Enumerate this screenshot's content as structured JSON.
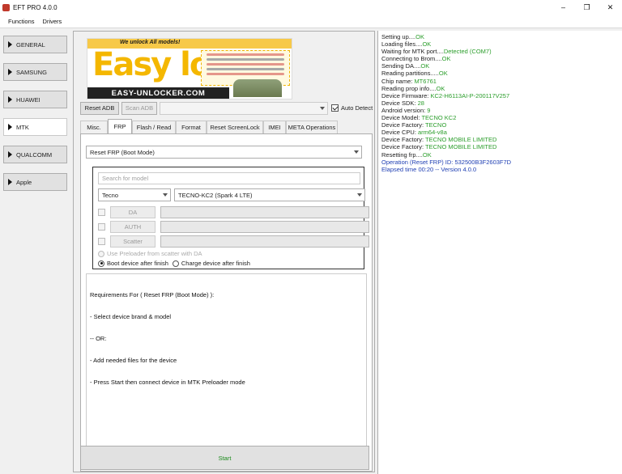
{
  "window": {
    "title": "EFT PRO 4.0.0",
    "minimize": "–",
    "restore": "❐",
    "close": "✕"
  },
  "menu": [
    "Functions",
    "Drivers"
  ],
  "sidebar": [
    {
      "label": "GENERAL",
      "active": false
    },
    {
      "label": "SAMSUNG",
      "active": false
    },
    {
      "label": "HUAWEI",
      "active": false
    },
    {
      "label": "MTK",
      "active": true
    },
    {
      "label": "QUALCOMM",
      "active": false
    },
    {
      "label": "Apple",
      "active": false
    }
  ],
  "banner": {
    "tagline": "We unlock All models!",
    "logo_text": "Easy locker",
    "url": "EASY-UNLOCKER.COM"
  },
  "adb": {
    "reset_label": "Reset ADB",
    "scan_label": "Scan ADB",
    "device_value": "",
    "auto_detect_label": "Auto Detect",
    "auto_detect_checked": true
  },
  "tabs": [
    "Misc.",
    "FRP",
    "Flash / Read",
    "Format",
    "Reset ScreenLock",
    "IMEI",
    "META Operations"
  ],
  "active_tab": "FRP",
  "frp": {
    "operation_value": "Reset FRP (Boot Mode)",
    "search_placeholder": "Search for model",
    "brand_value": "Tecno",
    "model_value": "TECNO-KC2 (Spark 4 LTE)",
    "da_label": "DA",
    "auth_label": "AUTH",
    "scatter_label": "Scatter",
    "use_preloader_label": "Use Preloader from scatter with DA",
    "boot_option": "Boot device after finish",
    "charge_option": "Charge device after finish",
    "selected_option": "boot"
  },
  "requirements": [
    "Requirements For ( Reset FRP (Boot Mode) ):",
    "- Select device brand & model",
    "-- OR:",
    "- Add needed files for the device",
    "- Press Start then connect device in MTK Preloader mode"
  ],
  "start_label": "Start",
  "colors": {
    "ok_green": "#2a9d2a",
    "info_blue": "#1f3fb3",
    "brand_yellow": "#f4b700"
  },
  "log": [
    [
      {
        "t": "Setting up....",
        "c": "black"
      },
      {
        "t": "OK",
        "c": "green"
      }
    ],
    [
      {
        "t": "Loading files....",
        "c": "black"
      },
      {
        "t": "OK",
        "c": "green"
      }
    ],
    [
      {
        "t": "Waiting for MTK port....",
        "c": "black"
      },
      {
        "t": "Detected (COM7)",
        "c": "green"
      }
    ],
    [
      {
        "t": "Connecting to Brom....",
        "c": "black"
      },
      {
        "t": "OK",
        "c": "green"
      }
    ],
    [
      {
        "t": "Sending DA....",
        "c": "black"
      },
      {
        "t": "OK",
        "c": "green"
      }
    ],
    [
      {
        "t": "Reading partitions.....",
        "c": "black"
      },
      {
        "t": "OK",
        "c": "green"
      }
    ],
    [
      {
        "t": "Chip name: ",
        "c": "black"
      },
      {
        "t": "MT6761",
        "c": "green"
      }
    ],
    [
      {
        "t": "Reading prop info....",
        "c": "black"
      },
      {
        "t": "OK",
        "c": "green"
      }
    ],
    [
      {
        "t": "Device Firmware: ",
        "c": "black"
      },
      {
        "t": "KC2-H6113AI-P-200117V257",
        "c": "green"
      }
    ],
    [
      {
        "t": "Device SDK: ",
        "c": "black"
      },
      {
        "t": "28",
        "c": "green"
      }
    ],
    [
      {
        "t": "Android version: ",
        "c": "black"
      },
      {
        "t": "9",
        "c": "green"
      }
    ],
    [
      {
        "t": "Device Model: ",
        "c": "black"
      },
      {
        "t": "TECNO KC2",
        "c": "green"
      }
    ],
    [
      {
        "t": "Device Factory: ",
        "c": "black"
      },
      {
        "t": "TECNO",
        "c": "green"
      }
    ],
    [
      {
        "t": "Device CPU: ",
        "c": "black"
      },
      {
        "t": "arm64-v8a",
        "c": "green"
      }
    ],
    [
      {
        "t": "Device Factory: ",
        "c": "black"
      },
      {
        "t": "TECNO MOBILE LIMITED",
        "c": "green"
      }
    ],
    [
      {
        "t": "Device Factory: ",
        "c": "black"
      },
      {
        "t": "TECNO MOBILE LIMITED",
        "c": "green"
      }
    ],
    [
      {
        "t": "Resetting frp....",
        "c": "black"
      },
      {
        "t": "OK",
        "c": "green"
      }
    ],
    [
      {
        "t": "Operation (Reset FRP) ID: 532500B3F2603F7D",
        "c": "blue"
      }
    ],
    [
      {
        "t": "Elapsed time 00:20 -- Version 4.0.0",
        "c": "blue"
      }
    ]
  ]
}
